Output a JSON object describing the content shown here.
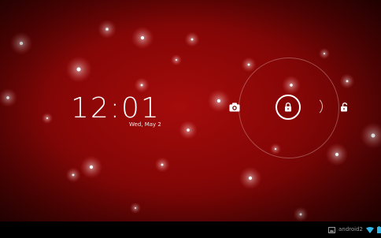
{
  "lockscreen": {
    "time": "12:01",
    "date": "Wed, May 2"
  },
  "targets": {
    "camera_icon": "camera-icon",
    "lock_icon": "lock-icon",
    "unlock_icon": "unlock-icon"
  },
  "status_bar": {
    "label": "android2",
    "icons": [
      "gallery-icon",
      "wifi-icon",
      "battery-icon"
    ]
  },
  "colors": {
    "background": "#860606",
    "accent": "#ffffff",
    "status_icon": "#33b5e5"
  }
}
